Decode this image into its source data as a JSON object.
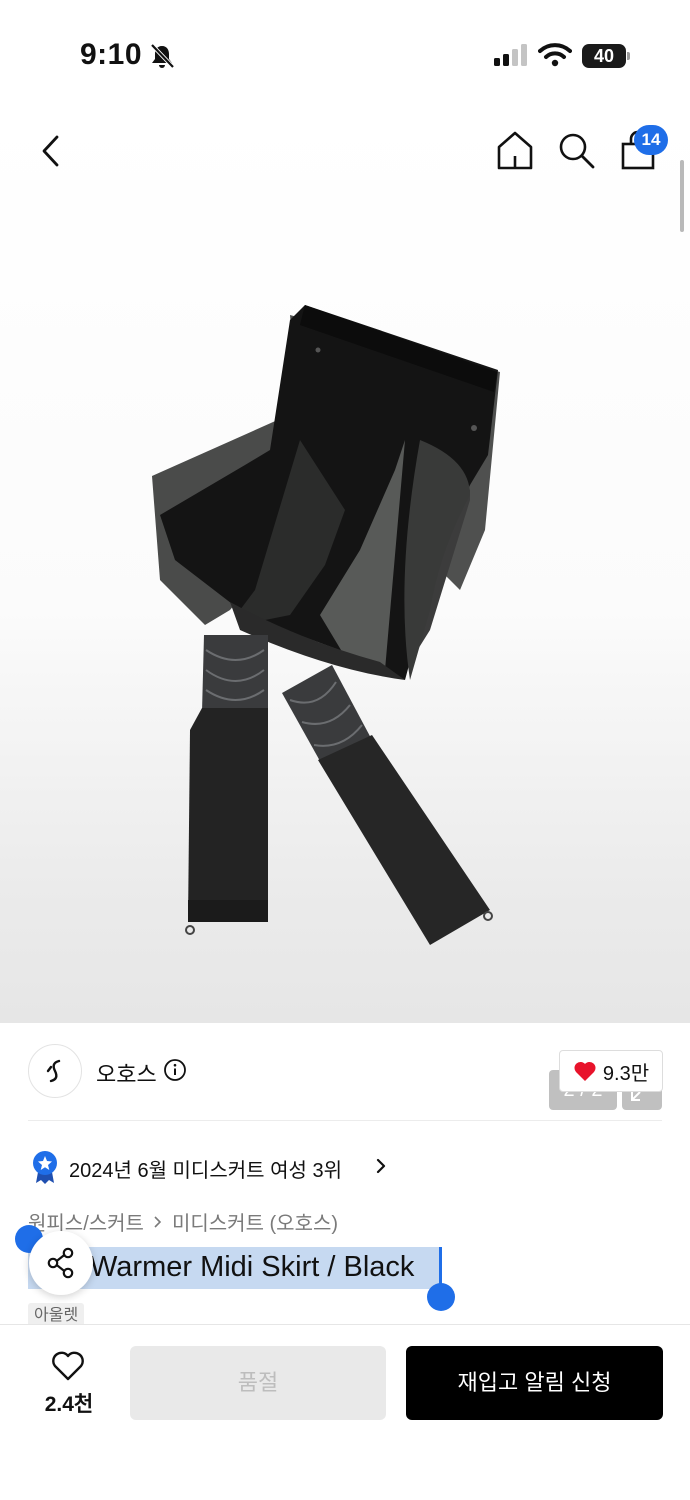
{
  "status_bar": {
    "time": "9:10",
    "battery": "40"
  },
  "nav": {
    "cart_count": "14"
  },
  "gallery": {
    "counter": "2 / 2"
  },
  "brand": {
    "name": "오호스",
    "likes": "9.3만"
  },
  "ranking": {
    "text": "2024년 6월 미디스커트 여성 3위"
  },
  "breadcrumb": {
    "category": "원피스/스커트",
    "subcategory": "미디스커트 (오호스)"
  },
  "product": {
    "title": "Warmer Midi Skirt / Black",
    "tag": "아울렛"
  },
  "bottom_bar": {
    "wish_count": "2.4천",
    "soldout_label": "품절",
    "restock_label": "재입고 알림 신청"
  },
  "colors": {
    "accent_blue": "#1f6ee8",
    "heart_red": "#e8132b",
    "selection": "#c6d9f1"
  }
}
